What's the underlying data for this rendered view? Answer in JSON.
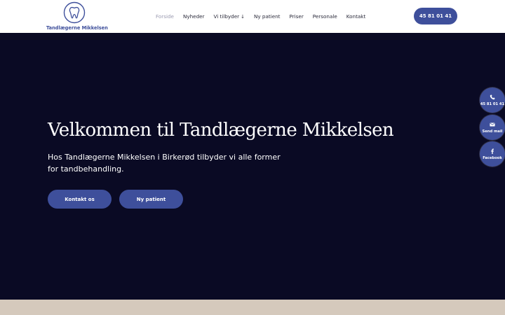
{
  "brand": {
    "name": "Tandlægerne Mikkelsen",
    "icon": "tooth-icon",
    "color": "#3e4f9b"
  },
  "nav": {
    "items": [
      {
        "label": "Forside",
        "active": true
      },
      {
        "label": "Nyheder"
      },
      {
        "label": "Vi tilbyder",
        "caret": "↓"
      },
      {
        "label": "Ny patient"
      },
      {
        "label": "Priser"
      },
      {
        "label": "Personale"
      },
      {
        "label": "Kontakt"
      }
    ],
    "phone_button": "45 81 01 41"
  },
  "hero": {
    "title": "Velkommen til Tandlægerne Mikkelsen",
    "subtitle": "Hos Tandlægerne Mikkelsen i Birkerød tilbyder vi alle former for tandbehandling.",
    "buttons": {
      "contact": "Kontakt os",
      "new_patient": "Ny patient"
    },
    "background_color": "#0a0a24"
  },
  "floating": {
    "phone": {
      "label": "45 81 01 41",
      "icon": "phone-icon"
    },
    "mail": {
      "label": "Send mail",
      "icon": "mail-icon"
    },
    "facebook": {
      "label": "Facebook",
      "icon": "facebook-icon"
    }
  }
}
